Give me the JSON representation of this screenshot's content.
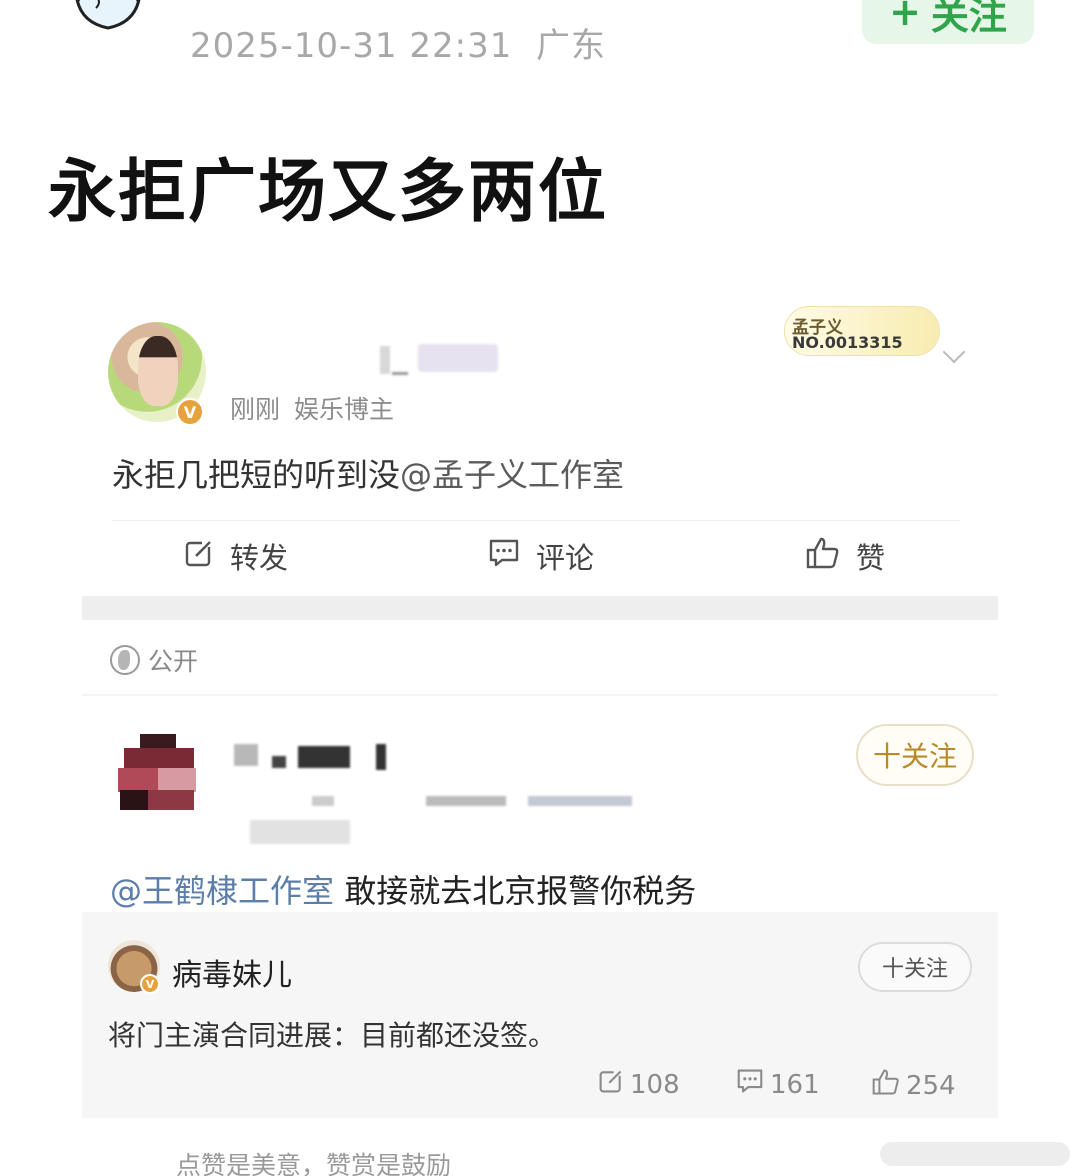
{
  "header": {
    "timestamp": "2025-10-31 22:31",
    "location": "广东",
    "follow_label": "关注",
    "follow_plus": "+",
    "title": "永拒广场又多两位"
  },
  "post1": {
    "time": "刚刚",
    "role": "娱乐博主",
    "badge": "V",
    "medal_name": "孟子义",
    "medal_no": "NO.0013315",
    "text_prefix": "永拒几把短的听到没",
    "mention": "@孟子义工作室",
    "actions": {
      "repost": "转发",
      "comment": "评论",
      "like": "赞"
    }
  },
  "visibility": {
    "label": "公开"
  },
  "post2": {
    "follow_label": "十关注",
    "mention": "@王鹤棣工作室",
    "text": " 敢接就去北京报警你税务"
  },
  "embed": {
    "name": "病毒妹儿",
    "badge": "V",
    "follow_label": "十关注",
    "text": "将门主演合同进展：目前都还没签。",
    "stats": {
      "repost": "108",
      "comment": "161",
      "like": "254"
    }
  },
  "footer": {
    "text": "点赞是美意，赞赏是鼓励"
  },
  "colors": {
    "follow_green": "#2fa44a",
    "follow_gold": "#b88a2a",
    "mention_blue": "#5c7ea8",
    "embed_bg": "#f6f6f6"
  }
}
